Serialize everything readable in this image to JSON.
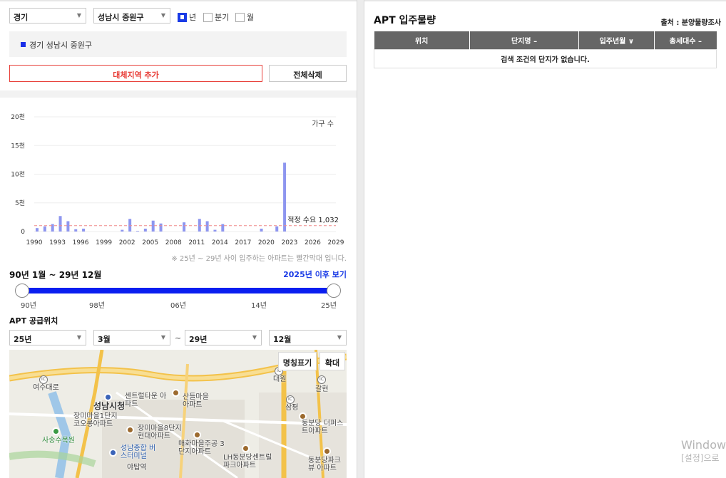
{
  "filters": {
    "province": "경기",
    "district": "성남시 중원구",
    "periods": [
      {
        "label": "년",
        "checked": true
      },
      {
        "label": "분기",
        "checked": false
      },
      {
        "label": "월",
        "checked": false
      }
    ]
  },
  "region_panel": {
    "label": "경기 성남시 중원구"
  },
  "buttons": {
    "add_region": "대체지역 추가",
    "clear_all": "전체삭제"
  },
  "chart_data": {
    "type": "bar",
    "title": "",
    "ylabel": "가구 수",
    "ylim": [
      0,
      20000
    ],
    "y_ticks": [
      "20천",
      "15천",
      "10천",
      "5천",
      "0"
    ],
    "x_ticks": [
      "1990",
      "1993",
      "1996",
      "1999",
      "2002",
      "2005",
      "2008",
      "2011",
      "2014",
      "2017",
      "2020",
      "2023",
      "2026",
      "2029"
    ],
    "x": [
      1990,
      1991,
      1992,
      1993,
      1994,
      1995,
      1996,
      1997,
      1998,
      1999,
      2000,
      2001,
      2002,
      2003,
      2004,
      2005,
      2006,
      2007,
      2008,
      2009,
      2010,
      2011,
      2012,
      2013,
      2014,
      2015,
      2016,
      2017,
      2018,
      2019,
      2020,
      2021,
      2022,
      2023,
      2024,
      2025,
      2026,
      2027,
      2028,
      2029
    ],
    "values": [
      600,
      900,
      1300,
      2700,
      1800,
      400,
      500,
      0,
      0,
      0,
      0,
      300,
      2200,
      100,
      500,
      1900,
      1400,
      0,
      0,
      1600,
      0,
      2200,
      1800,
      300,
      1300,
      0,
      0,
      0,
      0,
      500,
      0,
      900,
      12000,
      0,
      0,
      0,
      0,
      0,
      0,
      0
    ],
    "reference_line": {
      "label": "적정 수요 1,032",
      "value": 1032,
      "color": "#f08a8a"
    },
    "bar_color": "#8e96ef"
  },
  "chart_note": "※ 25년 ~ 29년 사이 입주하는 아파트는 빨간막대 입니다.",
  "range": {
    "title": "90년 1월 ~ 29년 12월",
    "link": "2025년 이후 보기",
    "labels": [
      "90년",
      "98년",
      "06년",
      "14년",
      "25년"
    ]
  },
  "supply": {
    "title": "APT 공급위치",
    "from_year": "25년",
    "from_month": "3월",
    "tilde": "~",
    "to_year": "29년",
    "to_month": "12월"
  },
  "map": {
    "btn_names": "명칭표기",
    "btn_zoom": "확대",
    "labels": [
      "여수대로",
      "성남시청",
      "센트럴타운 아파트",
      "산들마을 아파트",
      "장미마을1단지 코오롱아파트",
      "장미마을8단지 현대아파트",
      "매화마을주공 3단지아파트",
      "사송수목원",
      "성남종합 버스터미널",
      "야탑역",
      "LH동분당센트럴 파크아파트",
      "대원",
      "갈현",
      "삼평",
      "동분당 더퍼스트아파트",
      "동분당파크뷰 아파트"
    ]
  },
  "right": {
    "title": "APT 입주물량",
    "source": "출처 : 분양물량조사",
    "columns": [
      "위치",
      "단지명 –",
      "입주년월 ∨",
      "총세대수 –"
    ],
    "empty_message": "검색 조건의 단지가 없습니다."
  },
  "os_watermark": {
    "line1": "Windows",
    "line2": "[설정]으로"
  }
}
